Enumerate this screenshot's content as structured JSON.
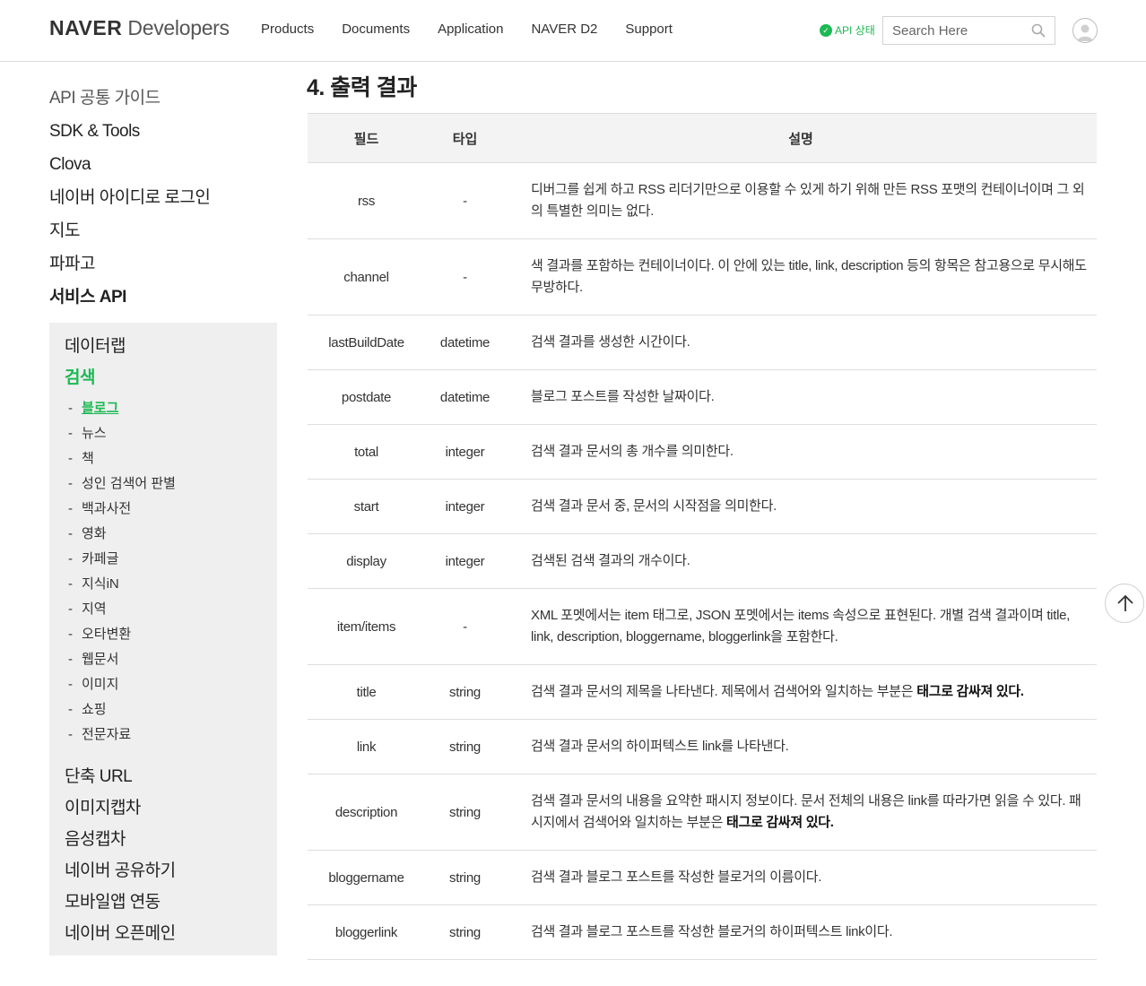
{
  "header": {
    "logo_brand": "NAVER",
    "logo_sub": "Developers",
    "nav": [
      "Products",
      "Documents",
      "Application",
      "NAVER D2",
      "Support"
    ],
    "api_status": "API 상태",
    "search_placeholder": "Search Here",
    "accent_color": "#1db954"
  },
  "sidebar": {
    "top_items": [
      "API 공통 가이드",
      "SDK & Tools",
      "Clova",
      "네이버 아이디로 로그인",
      "지도",
      "파파고",
      "서비스 API"
    ],
    "box_items_before": [
      "데이터랩",
      "검색"
    ],
    "sub_items": [
      "블로그",
      "뉴스",
      "책",
      "성인 검색어 판별",
      "백과사전",
      "영화",
      "카페글",
      "지식iN",
      "지역",
      "오타변환",
      "웹문서",
      "이미지",
      "쇼핑",
      "전문자료"
    ],
    "box_items_after": [
      "단축 URL",
      "이미지캡차",
      "음성캡차",
      "네이버 공유하기",
      "모바일앱 연동",
      "네이버 오픈메인"
    ]
  },
  "main": {
    "section_title": "4. 출력 결과",
    "columns": [
      "필드",
      "타입",
      "설명"
    ],
    "rows": [
      {
        "field": "rss",
        "type": "-",
        "desc": "디버그를 쉽게 하고 RSS 리더기만으로 이용할 수 있게 하기 위해 만든 RSS 포맷의 컨테이너이며 그 외의 특별한 의미는 없다.",
        "desc_bold": ""
      },
      {
        "field": "channel",
        "type": "-",
        "desc": "색 결과를 포함하는 컨테이너이다. 이 안에 있는 title, link, description 등의 항목은 참고용으로 무시해도 무방하다.",
        "desc_bold": ""
      },
      {
        "field": "lastBuildDate",
        "type": "datetime",
        "desc": "검색 결과를 생성한 시간이다.",
        "desc_bold": ""
      },
      {
        "field": "postdate",
        "type": "datetime",
        "desc": "블로그 포스트를 작성한 날짜이다.",
        "desc_bold": ""
      },
      {
        "field": "total",
        "type": "integer",
        "desc": "검색 결과 문서의 총 개수를 의미한다.",
        "desc_bold": ""
      },
      {
        "field": "start",
        "type": "integer",
        "desc": "검색 결과 문서 중, 문서의 시작점을 의미한다.",
        "desc_bold": ""
      },
      {
        "field": "display",
        "type": "integer",
        "desc": "검색된 검색 결과의 개수이다.",
        "desc_bold": ""
      },
      {
        "field": "item/items",
        "type": "-",
        "desc": "XML 포멧에서는 item 태그로, JSON 포멧에서는 items 속성으로 표현된다. 개별 검색 결과이며 title, link, description, bloggername, bloggerlink을 포함한다.",
        "desc_bold": ""
      },
      {
        "field": "title",
        "type": "string",
        "desc": "검색 결과 문서의 제목을 나타낸다. 제목에서 검색어와 일치하는 부분은 ",
        "desc_bold": "태그로 감싸져 있다."
      },
      {
        "field": "link",
        "type": "string",
        "desc": "검색 결과 문서의 하이퍼텍스트 link를 나타낸다.",
        "desc_bold": ""
      },
      {
        "field": "description",
        "type": "string",
        "desc": "검색 결과 문서의 내용을 요약한 패시지 정보이다. 문서 전체의 내용은 link를 따라가면 읽을 수 있다. 패시지에서 검색어와 일치하는 부분은 ",
        "desc_bold": "태그로 감싸져 있다."
      },
      {
        "field": "bloggername",
        "type": "string",
        "desc": "검색 결과 블로그 포스트를 작성한 블로거의 이름이다.",
        "desc_bold": ""
      },
      {
        "field": "bloggerlink",
        "type": "string",
        "desc": "검색 결과 블로그 포스트를 작성한 블로거의 하이퍼텍스트 link이다.",
        "desc_bold": ""
      }
    ]
  }
}
